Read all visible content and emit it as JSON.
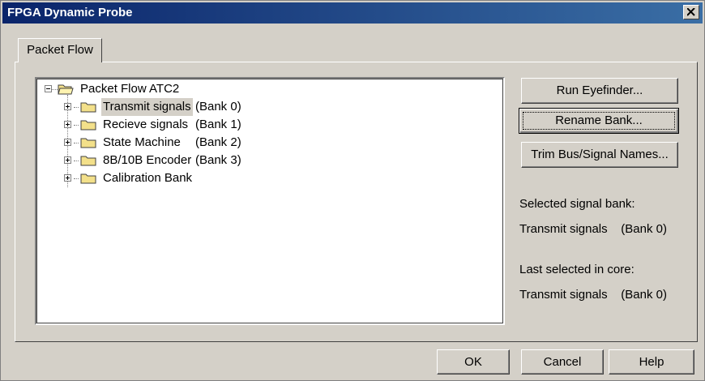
{
  "window": {
    "title": "FPGA Dynamic Probe"
  },
  "tabs": [
    {
      "label": "Packet Flow"
    }
  ],
  "tree": {
    "root": {
      "label": "Packet Flow ATC2"
    },
    "items": [
      {
        "label": "Transmit signals",
        "bank": "(Bank 0)"
      },
      {
        "label": "Recieve signals",
        "bank": "(Bank 1)"
      },
      {
        "label": "State Machine",
        "bank": "(Bank 2)"
      },
      {
        "label": "8B/10B Encoder",
        "bank": "(Bank 3)"
      },
      {
        "label": "Calibration Bank",
        "bank": ""
      }
    ]
  },
  "side_buttons": {
    "run_eyefinder": "Run Eyefinder...",
    "rename_bank": "Rename Bank...",
    "trim_names": "Trim Bus/Signal Names..."
  },
  "info": {
    "selected_label": "Selected signal bank:",
    "selected_value": "Transmit signals    (Bank 0)",
    "last_label": "Last selected in core:",
    "last_value": "Transmit signals    (Bank 0)"
  },
  "footer": {
    "ok": "OK",
    "cancel": "Cancel",
    "help": "Help"
  }
}
